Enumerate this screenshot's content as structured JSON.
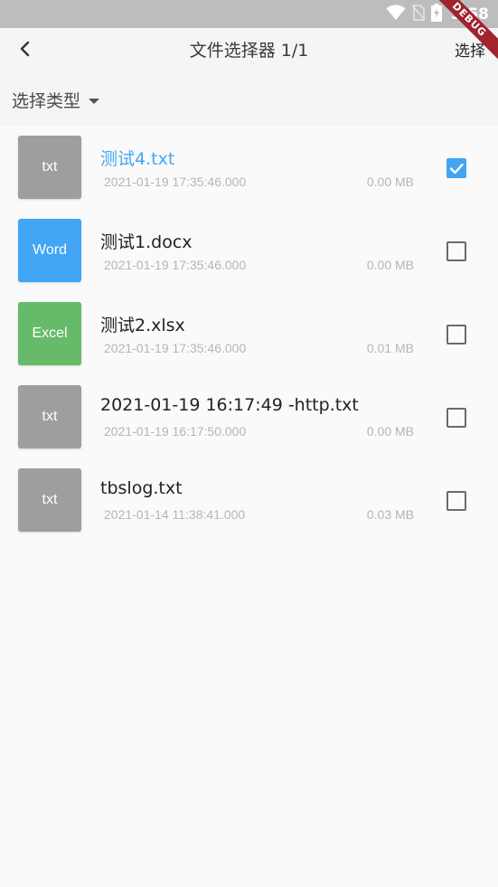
{
  "status_bar": {
    "time": "5:58",
    "icons": [
      "wifi-icon",
      "no-sim-icon",
      "battery-charging-icon"
    ]
  },
  "debug_banner": "DEBUG",
  "app_bar": {
    "back_icon": "chevron-left-icon",
    "title": "文件选择器  1/1",
    "action_label": "选择"
  },
  "filter": {
    "label": "选择类型",
    "icon": "caret-down-icon"
  },
  "colors": {
    "accent": "#42a5f5",
    "txt_icon": "#9e9e9e",
    "word_icon": "#42a5f5",
    "excel_icon": "#66bb6a"
  },
  "files": [
    {
      "icon_label": "txt",
      "icon_color": "#9e9e9e",
      "name": "测试4.txt",
      "date": "2021-01-19 17:35:46.000",
      "size": "0.00 MB",
      "checked": true
    },
    {
      "icon_label": "Word",
      "icon_color": "#42a5f5",
      "name": "测试1.docx",
      "date": "2021-01-19 17:35:46.000",
      "size": "0.00 MB",
      "checked": false
    },
    {
      "icon_label": "Excel",
      "icon_color": "#66bb6a",
      "name": "测试2.xlsx",
      "date": "2021-01-19 17:35:46.000",
      "size": "0.01 MB",
      "checked": false
    },
    {
      "icon_label": "txt",
      "icon_color": "#9e9e9e",
      "name": "2021-01-19 16:17:49 -http.txt",
      "date": "2021-01-19 16:17:50.000",
      "size": "0.00 MB",
      "checked": false
    },
    {
      "icon_label": "txt",
      "icon_color": "#9e9e9e",
      "name": "tbslog.txt",
      "date": "2021-01-14 11:38:41.000",
      "size": "0.03 MB",
      "checked": false
    }
  ]
}
